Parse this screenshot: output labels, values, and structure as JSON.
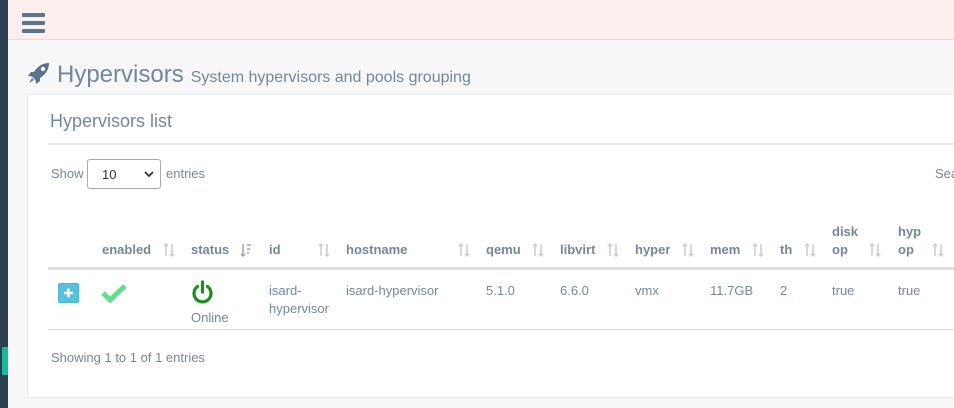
{
  "page": {
    "title": "Hypervisors",
    "subtitle": "System hypervisors and pools grouping"
  },
  "panel": {
    "title": "Hypervisors list"
  },
  "length_menu": {
    "show_label": "Show",
    "selected": "10",
    "entries_label": "entries"
  },
  "search": {
    "label": "Sea"
  },
  "table": {
    "columns": [
      {
        "line1": "enabled",
        "line2": ""
      },
      {
        "line1": "status",
        "line2": ""
      },
      {
        "line1": "id",
        "line2": ""
      },
      {
        "line1": "hostname",
        "line2": ""
      },
      {
        "line1": "qemu",
        "line2": ""
      },
      {
        "line1": "libvirt",
        "line2": ""
      },
      {
        "line1": "hyper",
        "line2": ""
      },
      {
        "line1": "mem",
        "line2": ""
      },
      {
        "line1": "th",
        "line2": ""
      },
      {
        "line1": "disk",
        "line2": "op"
      },
      {
        "line1": "hyp",
        "line2": "op"
      }
    ],
    "rows": [
      {
        "enabled_icon": "check-icon",
        "status_icon": "power-icon",
        "status": "Online",
        "id_line1": "isard-",
        "id_line2": "hypervisor",
        "hostname": "isard-hypervisor",
        "qemu": "5.1.0",
        "libvirt": "6.6.0",
        "hyper": "vmx",
        "mem": "11.7GB",
        "th": "2",
        "disk_op": "true",
        "hyp_op": "true"
      }
    ]
  },
  "footer": {
    "info": "Showing 1 to 1 of 1 entries"
  },
  "colors": {
    "sidebar": "#2a3f54",
    "topbar": "#fdeeee",
    "enabled_check": "#5ce08a",
    "status_online": "#1a8f1a",
    "expand_button": "#5bc0de"
  }
}
